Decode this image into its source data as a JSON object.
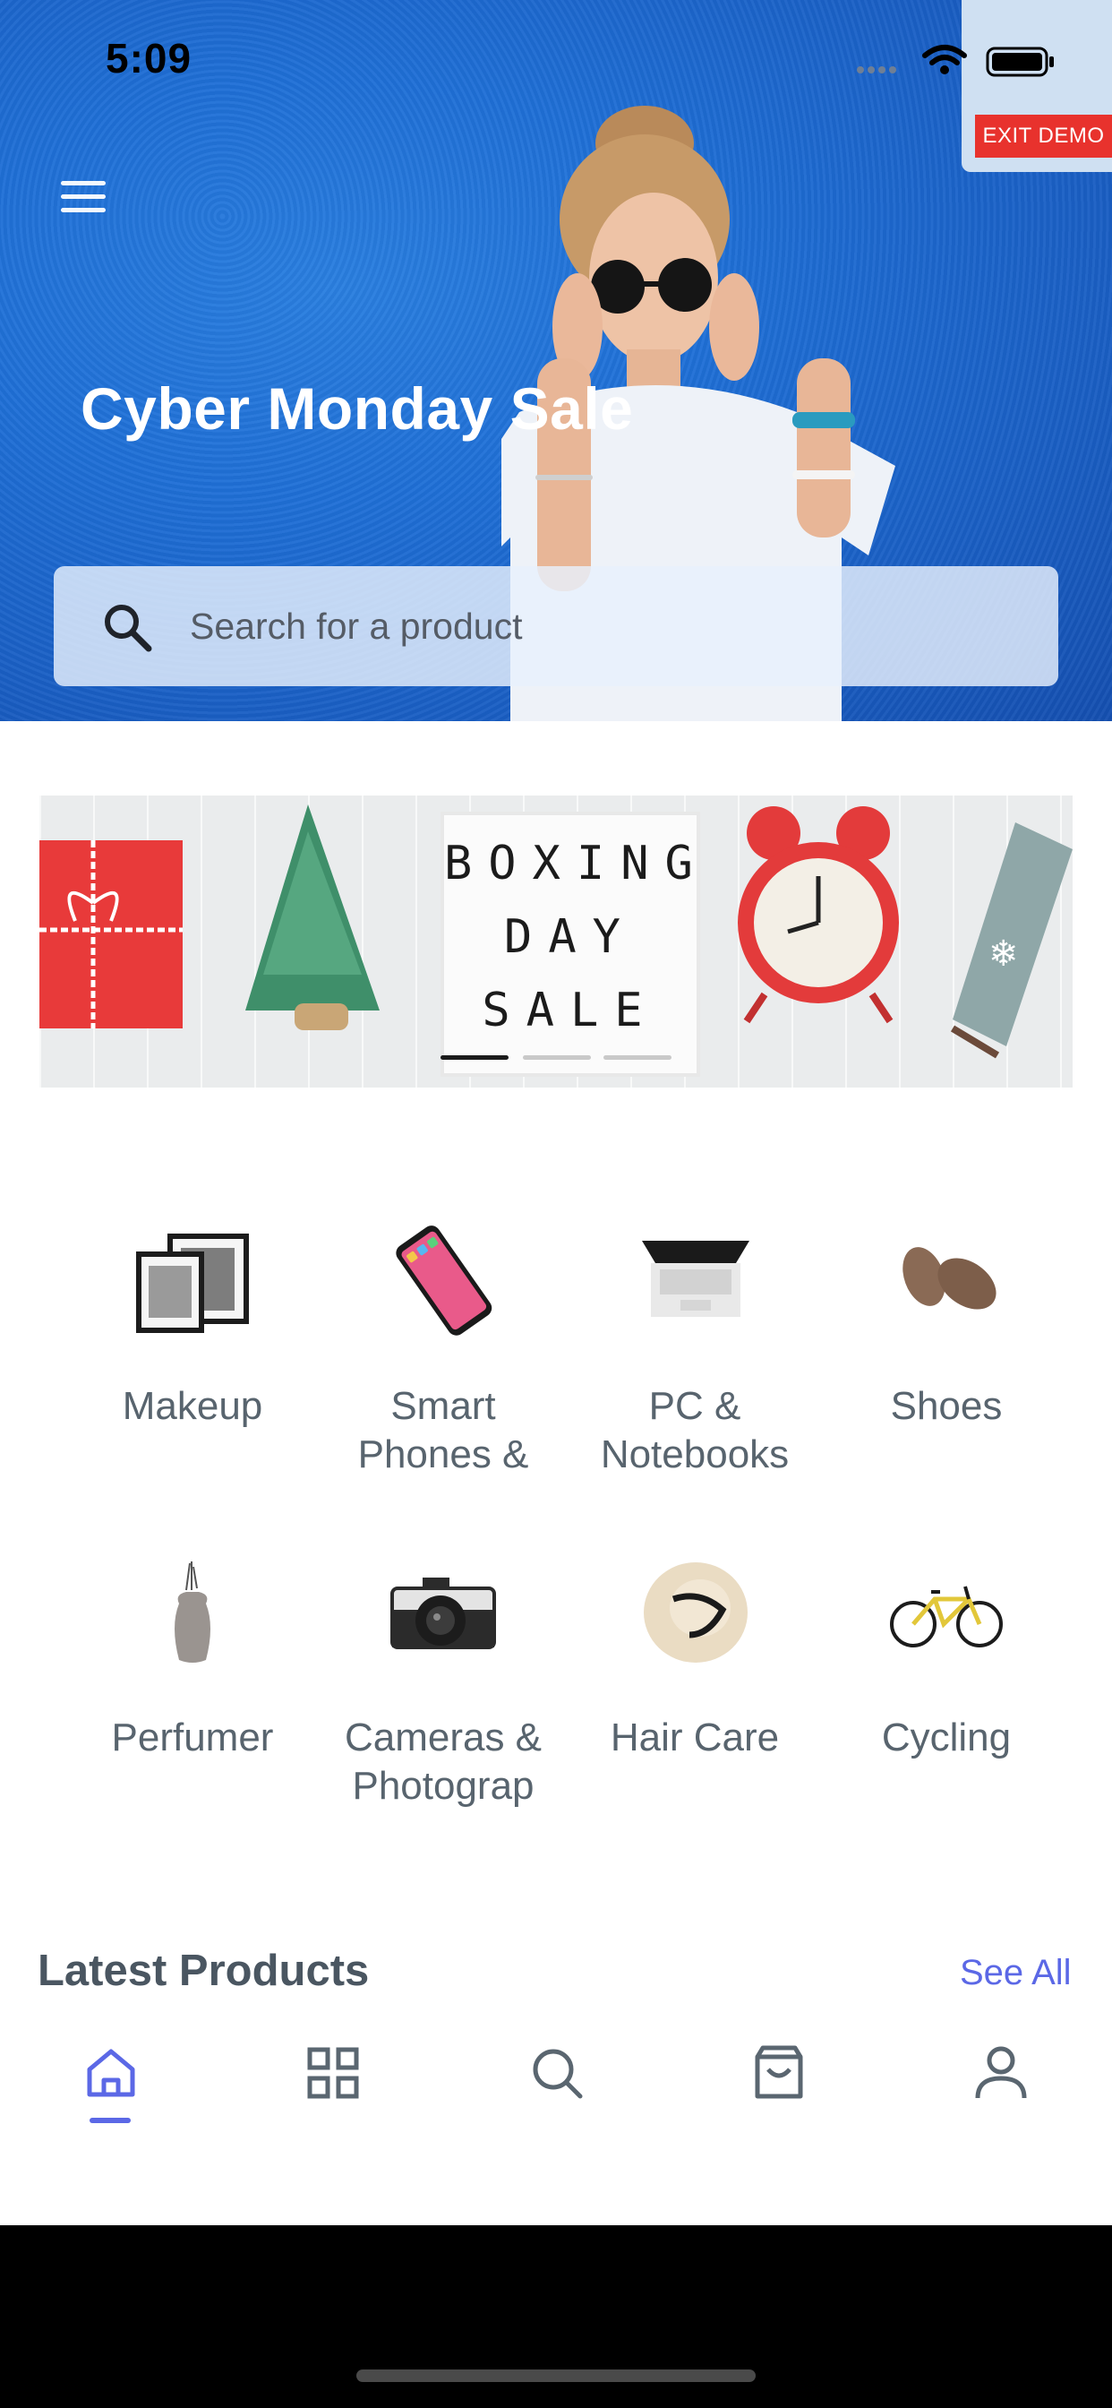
{
  "status_bar": {
    "time": "5:09"
  },
  "demo": {
    "exit_label": "EXIT DEMO"
  },
  "hero": {
    "title": "Cyber Monday Sale",
    "search_placeholder": "Search for a product"
  },
  "promo_banner": {
    "board_lines": [
      "BOXING",
      "DAY",
      "SALE"
    ],
    "pages": 3,
    "active_page": 1
  },
  "categories": [
    {
      "label": "Makeup",
      "icon": "photo-frames-icon"
    },
    {
      "label": "Smart\nPhones &",
      "icon": "smartphone-icon"
    },
    {
      "label": "PC &\nNotebooks",
      "icon": "laptop-icon"
    },
    {
      "label": "Shoes",
      "icon": "shoes-icon"
    },
    {
      "label": "Perfumer",
      "icon": "vase-icon"
    },
    {
      "label": "Cameras &\nPhotograp",
      "icon": "camera-icon"
    },
    {
      "label": "Hair Care",
      "icon": "hat-icon"
    },
    {
      "label": "Cycling",
      "icon": "bicycle-icon"
    }
  ],
  "latest": {
    "title": "Latest Products",
    "see_all": "See All"
  },
  "tabbar": {
    "items": [
      {
        "name": "home",
        "icon": "home-icon",
        "active": true
      },
      {
        "name": "categories",
        "icon": "grid-icon",
        "active": false
      },
      {
        "name": "search",
        "icon": "search-icon",
        "active": false
      },
      {
        "name": "cart",
        "icon": "shopping-bag-icon",
        "active": false
      },
      {
        "name": "profile",
        "icon": "user-icon",
        "active": false
      }
    ]
  },
  "colors": {
    "accent": "#5b68e6",
    "hero_blue": "#1f6fd6",
    "exit_demo": "#e8322d",
    "text_gray": "#58646e"
  }
}
